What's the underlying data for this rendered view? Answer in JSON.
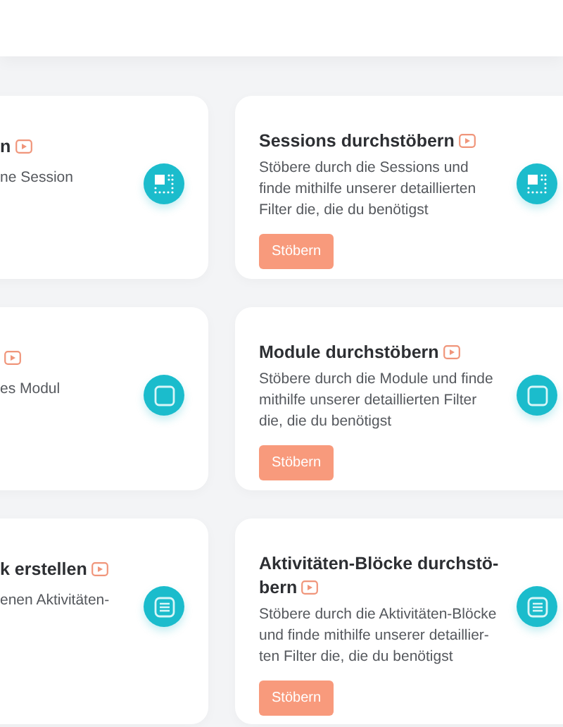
{
  "left_cards": [
    {
      "title": "n",
      "description": "ne Session"
    },
    {
      "description": "es Modul"
    },
    {
      "title": "k erstellen",
      "description": "enen Aktivitäten-"
    }
  ],
  "right_cards": [
    {
      "title": "Sessions durchstöbern",
      "description": "Stöbere durch die Sessions und finde mithilfe unserer detaillierten Filter die, die du benötigst",
      "button": "Stöbern"
    },
    {
      "title": "Module durchstöbern",
      "description": "Stöbere durch die Module und finde mithilfe unserer detaillierten Filter die, die du benötigst",
      "button": "Stöbern"
    },
    {
      "title": "Aktivitäten-Blöcke durchstö-bern",
      "description": "Stöbere durch die Aktivitäten-Blöcke und finde mithilfe unserer detaillier-ten Filter die, die du benötigst",
      "button": "Stöbern"
    }
  ]
}
